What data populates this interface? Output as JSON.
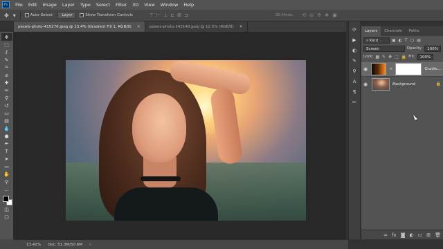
{
  "app": {
    "logo": "Ps"
  },
  "menu": [
    "File",
    "Edit",
    "Image",
    "Layer",
    "Type",
    "Select",
    "Filter",
    "3D",
    "View",
    "Window",
    "Help"
  ],
  "options": {
    "auto_select_label": "Auto-Select:",
    "auto_select_value": "Layer",
    "show_transform_label": "Show Transform Controls",
    "mode_3d_label": "3D Mode:"
  },
  "tabs": [
    {
      "label": "pexels-photo-415276.jpeg @ 13.4% (Gradient Fill 1, RGB/8)",
      "close": "×"
    },
    {
      "label": "pexels-photo-242148.jpeg @ 12.5% (RGB/8)",
      "close": "×"
    }
  ],
  "panel": {
    "tabs": [
      "Layers",
      "Channels",
      "Paths"
    ],
    "filter_kind": "Kind",
    "blend_mode": "Screen",
    "opacity_label": "Opacity:",
    "opacity_value": "100%",
    "lock_label": "Lock:",
    "fill_label": "Fill:",
    "fill_value": "100%",
    "layers": [
      {
        "name": "Gradie...",
        "selected": true
      },
      {
        "name": "Background",
        "selected": false
      }
    ]
  },
  "status": {
    "zoom": "13.41%",
    "doc": "Doc: 51.3M/50.6M"
  },
  "icons": {
    "eye": "eye-icon",
    "lock": "lock-icon",
    "link": "link-icon"
  }
}
